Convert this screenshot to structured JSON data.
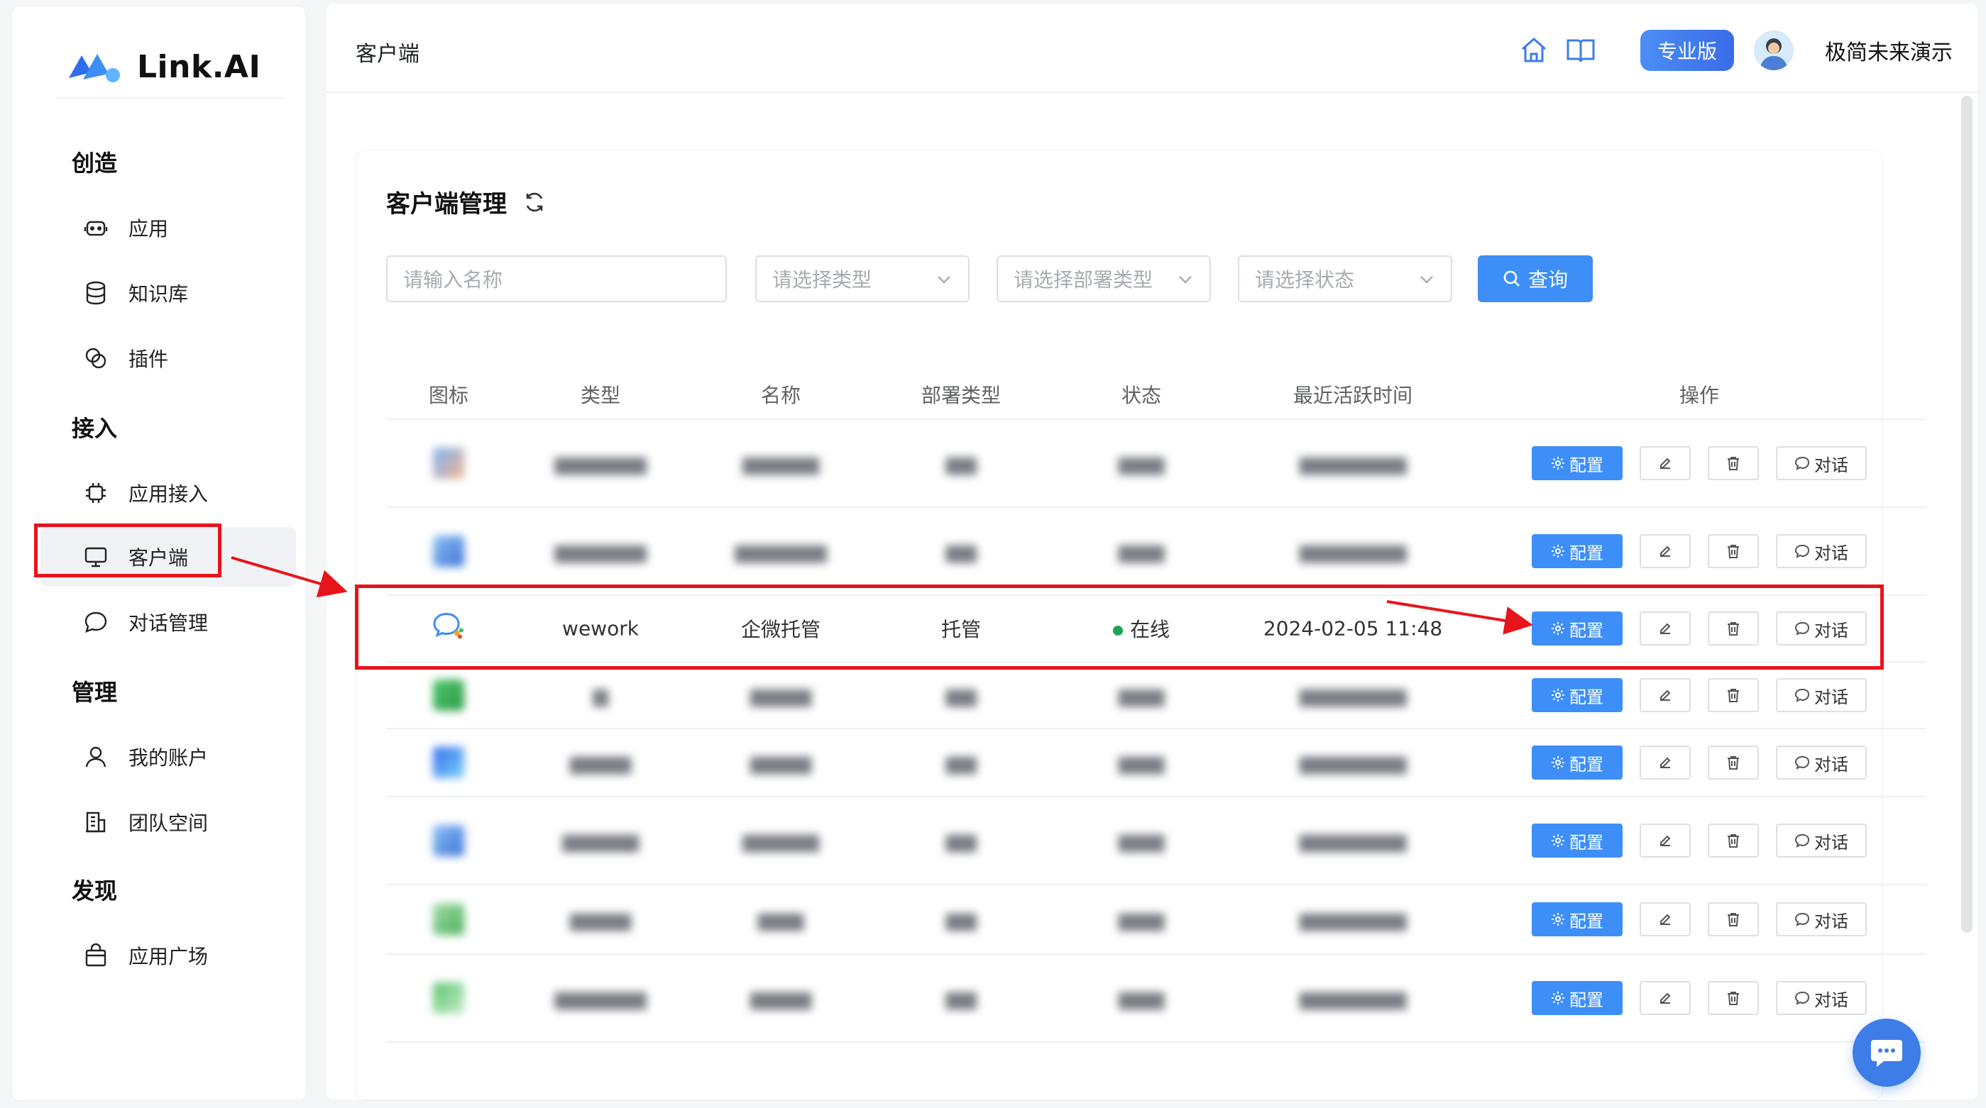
{
  "brand": {
    "name": "Link.AI"
  },
  "sidebar": {
    "sections": [
      {
        "title": "创造",
        "items": [
          {
            "label": "应用",
            "icon": "robot-icon"
          },
          {
            "label": "知识库",
            "icon": "database-icon"
          },
          {
            "label": "插件",
            "icon": "plugin-icon"
          }
        ]
      },
      {
        "title": "接入",
        "items": [
          {
            "label": "应用接入",
            "icon": "chip-icon"
          },
          {
            "label": "客户端",
            "icon": "monitor-icon",
            "active": true
          },
          {
            "label": "对话管理",
            "icon": "chat-bubble-icon"
          }
        ]
      },
      {
        "title": "管理",
        "items": [
          {
            "label": "我的账户",
            "icon": "user-icon"
          },
          {
            "label": "团队空间",
            "icon": "building-icon"
          }
        ]
      },
      {
        "title": "发现",
        "items": [
          {
            "label": "应用广场",
            "icon": "shopping-bag-icon"
          }
        ]
      }
    ]
  },
  "header": {
    "breadcrumb": "客户端",
    "plan_badge": "专业版",
    "username": "极简未来演示"
  },
  "card": {
    "title": "客户端管理"
  },
  "filters": {
    "name_placeholder": "请输入名称",
    "type_placeholder": "请选择类型",
    "deploy_placeholder": "请选择部署类型",
    "status_placeholder": "请选择状态",
    "query_label": "查询"
  },
  "table": {
    "columns": [
      "图标",
      "类型",
      "名称",
      "部署类型",
      "状态",
      "最近活跃时间",
      "操作"
    ],
    "actions": {
      "config": "配置",
      "chat": "对话"
    },
    "highlighted_row": {
      "type": "wework",
      "name": "企微托管",
      "deploy": "托管",
      "status": "在线",
      "last_active": "2024-02-05 11:48"
    }
  },
  "colors": {
    "primary": "#3d8ef6",
    "highlight": "#e8141b",
    "online": "#22a35a"
  }
}
